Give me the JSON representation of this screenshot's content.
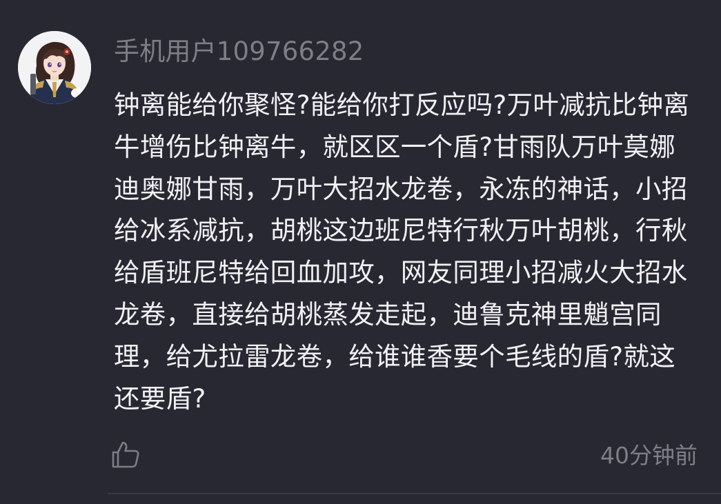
{
  "comment": {
    "avatar_icon": "user-avatar-anime-character",
    "username": "手机用户109766282",
    "text": "钟离能给你聚怪?能给你打反应吗?万叶减抗比钟离牛增伤比钟离牛，就区区一个盾?甘雨队万叶莫娜迪奥娜甘雨，万叶大招水龙卷，永冻的神话，小招给冰系减抗，胡桃这边班尼特行秋万叶胡桃，行秋给盾班尼特给回血加攻，网友同理小招减火大招水龙卷，直接给胡桃蒸发走起，迪鲁克神里魈宫同理，给尤拉雷龙卷，给谁谁香要个毛线的盾?就这还要盾?",
    "like_icon": "thumbs-up-icon",
    "time": "40分钟前"
  },
  "colors": {
    "background": "#282833",
    "primary_text": "#f1f1f3",
    "secondary_text": "#7e7e85",
    "divider": "#3a3a45"
  }
}
